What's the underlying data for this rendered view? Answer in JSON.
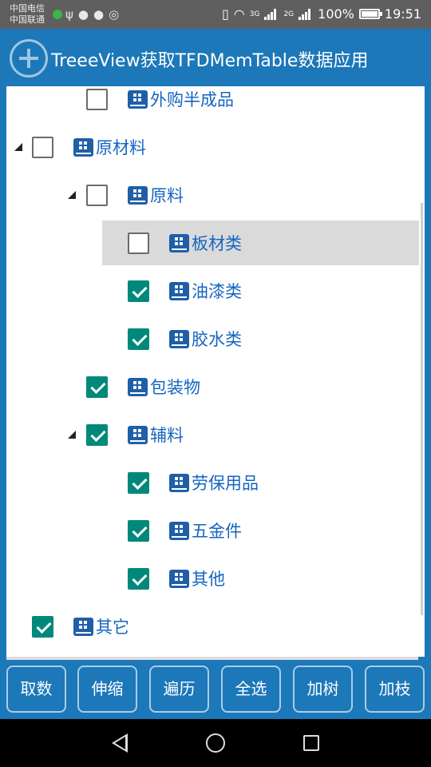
{
  "status_bar": {
    "carrier_1": "中国电信",
    "carrier_2": "中国联通",
    "net_3g": "3G",
    "net_2g": "2G",
    "battery": "100%",
    "time": "19:51"
  },
  "app": {
    "title": "TreeeView获取TFDMemTable数据应用"
  },
  "tree": {
    "nodes": [
      {
        "label": "外购半成品",
        "checked": false,
        "level": 1,
        "has_children": false
      },
      {
        "label": "原材料",
        "checked": false,
        "level": 0,
        "has_children": true,
        "expanded": true
      },
      {
        "label": "原料",
        "checked": false,
        "level": 1,
        "has_children": true,
        "expanded": true
      },
      {
        "label": "板材类",
        "checked": false,
        "level": 2,
        "has_children": false,
        "selected": true
      },
      {
        "label": "油漆类",
        "checked": true,
        "level": 2,
        "has_children": false
      },
      {
        "label": "胶水类",
        "checked": true,
        "level": 2,
        "has_children": false
      },
      {
        "label": "包装物",
        "checked": true,
        "level": 1,
        "has_children": false
      },
      {
        "label": "辅料",
        "checked": true,
        "level": 1,
        "has_children": true,
        "expanded": true
      },
      {
        "label": "劳保用品",
        "checked": true,
        "level": 2,
        "has_children": false
      },
      {
        "label": "五金件",
        "checked": true,
        "level": 2,
        "has_children": false
      },
      {
        "label": "其他",
        "checked": true,
        "level": 2,
        "has_children": false
      },
      {
        "label": "其它",
        "checked": true,
        "level": 0,
        "has_children": false
      }
    ]
  },
  "buttons": [
    {
      "id": "fetch",
      "label": "取数"
    },
    {
      "id": "expand-collapse",
      "label": "伸缩"
    },
    {
      "id": "traverse",
      "label": "遍历"
    },
    {
      "id": "select-all",
      "label": "全选"
    },
    {
      "id": "add-tree",
      "label": "加树"
    },
    {
      "id": "add-branch",
      "label": "加枝"
    }
  ],
  "colors": {
    "primary": "#1c78b8",
    "check_on": "#00897b",
    "node_text": "#1565c0",
    "selected_row": "#dadada"
  }
}
